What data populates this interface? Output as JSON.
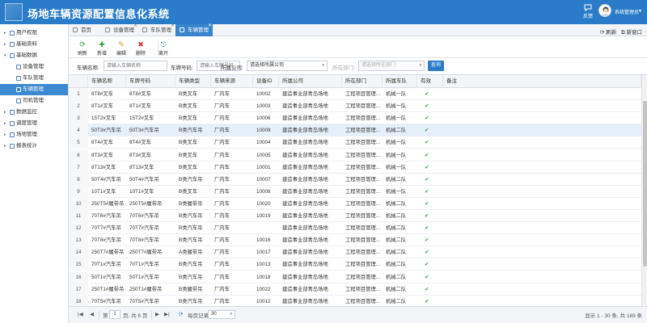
{
  "app": {
    "title": "场地车辆资源配置信息化系统",
    "message_label": "反馈",
    "user_name": "系统管理员"
  },
  "sidebar": {
    "items": [
      {
        "label": "用户权限",
        "arrow": "▸",
        "sub": false,
        "active": false
      },
      {
        "label": "基础资料",
        "arrow": "▸",
        "sub": false,
        "active": false
      },
      {
        "label": "基础数据",
        "arrow": "▾",
        "sub": false,
        "active": false
      },
      {
        "label": "设备管理",
        "arrow": "",
        "sub": true,
        "active": false
      },
      {
        "label": "车队管理",
        "arrow": "",
        "sub": true,
        "active": false
      },
      {
        "label": "车辆管理",
        "arrow": "",
        "sub": true,
        "active": true
      },
      {
        "label": "司机管理",
        "arrow": "",
        "sub": true,
        "active": false
      },
      {
        "label": "数据监控",
        "arrow": "▸",
        "sub": false,
        "active": false
      },
      {
        "label": "调度管理",
        "arrow": "▸",
        "sub": false,
        "active": false
      },
      {
        "label": "场地管理",
        "arrow": "▸",
        "sub": false,
        "active": false
      },
      {
        "label": "报表统计",
        "arrow": "▸",
        "sub": false,
        "active": false
      }
    ]
  },
  "tabs": [
    {
      "label": "首页",
      "closable": false,
      "active": false
    },
    {
      "label": "设备管理",
      "closable": true,
      "active": false
    },
    {
      "label": "车队管理",
      "closable": true,
      "active": false
    },
    {
      "label": "车辆管理",
      "closable": true,
      "active": true
    }
  ],
  "tab_actions": {
    "refresh": "刷新",
    "new_window": "新窗口"
  },
  "toolbar": {
    "refresh": "刷新",
    "add": "新增",
    "edit": "编辑",
    "delete": "删除",
    "exit": "离开"
  },
  "filters": {
    "name_label": "车辆名称:",
    "name_placeholder": "请输入车辆名称",
    "plate_label": "车牌号码:",
    "plate_placeholder": "请输入车牌号码",
    "company_label": "所属公司:",
    "company_value": "请选择所属公司",
    "dept_label": "所在部门:",
    "dept_value": "请选择所在部门",
    "search_button": "查询"
  },
  "table": {
    "columns": [
      "车辆名称",
      "车牌号码",
      "车辆类型",
      "车辆来源",
      "设备ID",
      "所属公司",
      "所在部门",
      "所属车队",
      "有效",
      "备注"
    ],
    "rows": [
      {
        "n": "1",
        "name": "8T8#叉车",
        "plate": "8T8#叉车",
        "type": "B类叉车",
        "source": "厂内车",
        "device": "10002",
        "company": "建造事业部青岛场地",
        "dept": "工程项目管理...",
        "fleet": "机械一队",
        "valid": "✔",
        "remark": ""
      },
      {
        "n": "2",
        "name": "8T1#叉车",
        "plate": "8T1#叉车",
        "type": "B类叉车",
        "source": "厂内车",
        "device": "10003",
        "company": "建造事业部青岛场地",
        "dept": "工程项目管理...",
        "fleet": "机械一队",
        "valid": "✔",
        "remark": ""
      },
      {
        "n": "3",
        "name": "15T2#叉车",
        "plate": "15T2#叉车",
        "type": "B类叉车",
        "source": "厂内车",
        "device": "10006",
        "company": "建造事业部青岛场地",
        "dept": "工程项目管理...",
        "fleet": "机械一队",
        "valid": "✔",
        "remark": ""
      },
      {
        "n": "4",
        "name": "50T3#汽车吊",
        "plate": "50T3#汽车吊",
        "type": "B类汽车吊",
        "source": "厂内车",
        "device": "10009",
        "company": "建造事业部青岛场地",
        "dept": "工程项目管理...",
        "fleet": "机械二队",
        "valid": "✔",
        "remark": ""
      },
      {
        "n": "5",
        "name": "8T4#叉车",
        "plate": "8T4#叉车",
        "type": "B类叉车",
        "source": "厂内车",
        "device": "10004",
        "company": "建造事业部青岛场地",
        "dept": "工程项目管理...",
        "fleet": "机械一队",
        "valid": "✔",
        "remark": ""
      },
      {
        "n": "6",
        "name": "8T3#叉车",
        "plate": "8T3#叉车",
        "type": "B类叉车",
        "source": "厂内车",
        "device": "10005",
        "company": "建造事业部青岛场地",
        "dept": "工程项目管理...",
        "fleet": "机械一队",
        "valid": "✔",
        "remark": ""
      },
      {
        "n": "7",
        "name": "8T13#叉车",
        "plate": "8T13#叉车",
        "type": "B类叉车",
        "source": "厂内车",
        "device": "10001",
        "company": "建造事业部青岛场地",
        "dept": "工程项目管理...",
        "fleet": "机械一队",
        "valid": "✔",
        "remark": ""
      },
      {
        "n": "8",
        "name": "50T4#汽车吊",
        "plate": "50T4#汽车吊",
        "type": "B类汽车吊",
        "source": "厂内车",
        "device": "10007",
        "company": "建造事业部青岛场地",
        "dept": "工程项目管理...",
        "fleet": "机械二队",
        "valid": "✔",
        "remark": ""
      },
      {
        "n": "9",
        "name": "10T1#叉车",
        "plate": "10T1#叉车",
        "type": "B类叉车",
        "source": "厂内车",
        "device": "10008",
        "company": "建造事业部青岛场地",
        "dept": "工程项目管理...",
        "fleet": "机械一队",
        "valid": "✔",
        "remark": ""
      },
      {
        "n": "10",
        "name": "250T5#履带吊",
        "plate": "250T5#履带吊",
        "type": "B类履带吊",
        "source": "厂内车",
        "device": "10020",
        "company": "建造事业部青岛场地",
        "dept": "工程项目管理...",
        "fleet": "机械二队",
        "valid": "✔",
        "remark": ""
      },
      {
        "n": "11",
        "name": "70T6#汽车吊",
        "plate": "70T6#汽车吊",
        "type": "B类汽车吊",
        "source": "厂内车",
        "device": "10019",
        "company": "建造事业部青岛场地",
        "dept": "工程项目管理...",
        "fleet": "机械二队",
        "valid": "✔",
        "remark": ""
      },
      {
        "n": "12",
        "name": "70T7#汽车吊",
        "plate": "70T7#汽车吊",
        "type": "B类汽车吊",
        "source": "厂内车",
        "device": "",
        "company": "建造事业部青岛场地",
        "dept": "工程项目管理...",
        "fleet": "机械二队",
        "valid": "✔",
        "remark": ""
      },
      {
        "n": "13",
        "name": "70T8#汽车吊",
        "plate": "70T8#汽车吊",
        "type": "B类汽车吊",
        "source": "厂内车",
        "device": "10016",
        "company": "建造事业部青岛场地",
        "dept": "工程项目管理...",
        "fleet": "机械二队",
        "valid": "✔",
        "remark": ""
      },
      {
        "n": "14",
        "name": "250T7#履带吊",
        "plate": "250T7#履带吊",
        "type": "A类履带吊",
        "source": "厂内车",
        "device": "10017",
        "company": "建造事业部青岛场地",
        "dept": "工程项目管理...",
        "fleet": "机械二队",
        "valid": "✔",
        "remark": ""
      },
      {
        "n": "15",
        "name": "70T1#汽车吊",
        "plate": "70T1#汽车吊",
        "type": "B类汽车吊",
        "source": "厂内车",
        "device": "10013",
        "company": "建造事业部青岛场地",
        "dept": "工程项目管理...",
        "fleet": "机械二队",
        "valid": "✔",
        "remark": ""
      },
      {
        "n": "16",
        "name": "50T1#汽车吊",
        "plate": "50T1#汽车吊",
        "type": "B类汽车吊",
        "source": "厂内车",
        "device": "10018",
        "company": "建造事业部青岛场地",
        "dept": "工程项目管理...",
        "fleet": "机械二队",
        "valid": "✔",
        "remark": ""
      },
      {
        "n": "17",
        "name": "250T1#履带吊",
        "plate": "250T1#履带吊",
        "type": "B类履带吊",
        "source": "厂内车",
        "device": "10022",
        "company": "建造事业部青岛场地",
        "dept": "工程项目管理...",
        "fleet": "机械二队",
        "valid": "✔",
        "remark": ""
      },
      {
        "n": "18",
        "name": "70T5#汽车吊",
        "plate": "70T5#汽车吊",
        "type": "B类汽车吊",
        "source": "厂内车",
        "device": "10012",
        "company": "建造事业部青岛场地",
        "dept": "工程项目管理...",
        "fleet": "机械二队",
        "valid": "✔",
        "remark": ""
      }
    ]
  },
  "pager": {
    "page_prefix": "第",
    "page_value": "1",
    "page_suffix": "页, 共 6 页",
    "size_label": "每页记录数:",
    "size_value": "30",
    "summary": "显示 1 - 30 条, 共 169 条"
  }
}
